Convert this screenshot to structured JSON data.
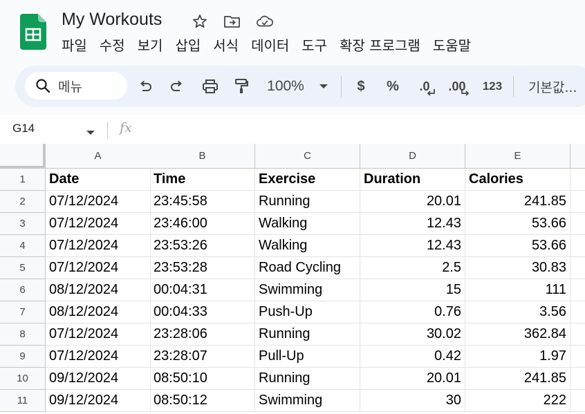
{
  "doc": {
    "title": "My Workouts"
  },
  "menu": [
    "파일",
    "수정",
    "보기",
    "삽입",
    "서식",
    "데이터",
    "도구",
    "확장 프로그램",
    "도움말"
  ],
  "toolbar": {
    "search_label": "메뉴",
    "zoom": "100%",
    "currency": "$",
    "percent": "%",
    "decrease_decimal": ".0",
    "increase_decimal": ".00",
    "number_format": "123",
    "font_default": "기본값..."
  },
  "formula_bar": {
    "cell_ref": "G14",
    "fx": "fx"
  },
  "sheet": {
    "columns": [
      "A",
      "B",
      "C",
      "D",
      "E"
    ],
    "rows": [
      {
        "num": "1",
        "cells": [
          "Date",
          "Time",
          "Exercise",
          "Duration",
          "Calories"
        ]
      },
      {
        "num": "2",
        "cells": [
          "07/12/2024",
          "23:45:58",
          "Running",
          "20.01",
          "241.85"
        ]
      },
      {
        "num": "3",
        "cells": [
          "07/12/2024",
          "23:46:00",
          "Walking",
          "12.43",
          "53.66"
        ]
      },
      {
        "num": "4",
        "cells": [
          "07/12/2024",
          "23:53:26",
          "Walking",
          "12.43",
          "53.66"
        ]
      },
      {
        "num": "5",
        "cells": [
          "07/12/2024",
          "23:53:28",
          "Road Cycling",
          "2.5",
          "30.83"
        ]
      },
      {
        "num": "6",
        "cells": [
          "08/12/2024",
          "00:04:31",
          "Swimming",
          "15",
          "111"
        ]
      },
      {
        "num": "7",
        "cells": [
          "08/12/2024",
          "00:04:33",
          "Push-Up",
          "0.76",
          "3.56"
        ]
      },
      {
        "num": "8",
        "cells": [
          "07/12/2024",
          "23:28:06",
          "Running",
          "30.02",
          "362.84"
        ]
      },
      {
        "num": "9",
        "cells": [
          "07/12/2024",
          "23:28:07",
          "Pull-Up",
          "0.42",
          "1.97"
        ]
      },
      {
        "num": "10",
        "cells": [
          "09/12/2024",
          "08:50:10",
          "Running",
          "20.01",
          "241.85"
        ]
      },
      {
        "num": "11",
        "cells": [
          "09/12/2024",
          "08:50:12",
          "Swimming",
          "30",
          "222"
        ]
      }
    ]
  },
  "colors": {
    "sheets_green": "#0f9d58",
    "toolbar_bg": "#edf2fa",
    "header_bg": "#f8f9fa"
  }
}
